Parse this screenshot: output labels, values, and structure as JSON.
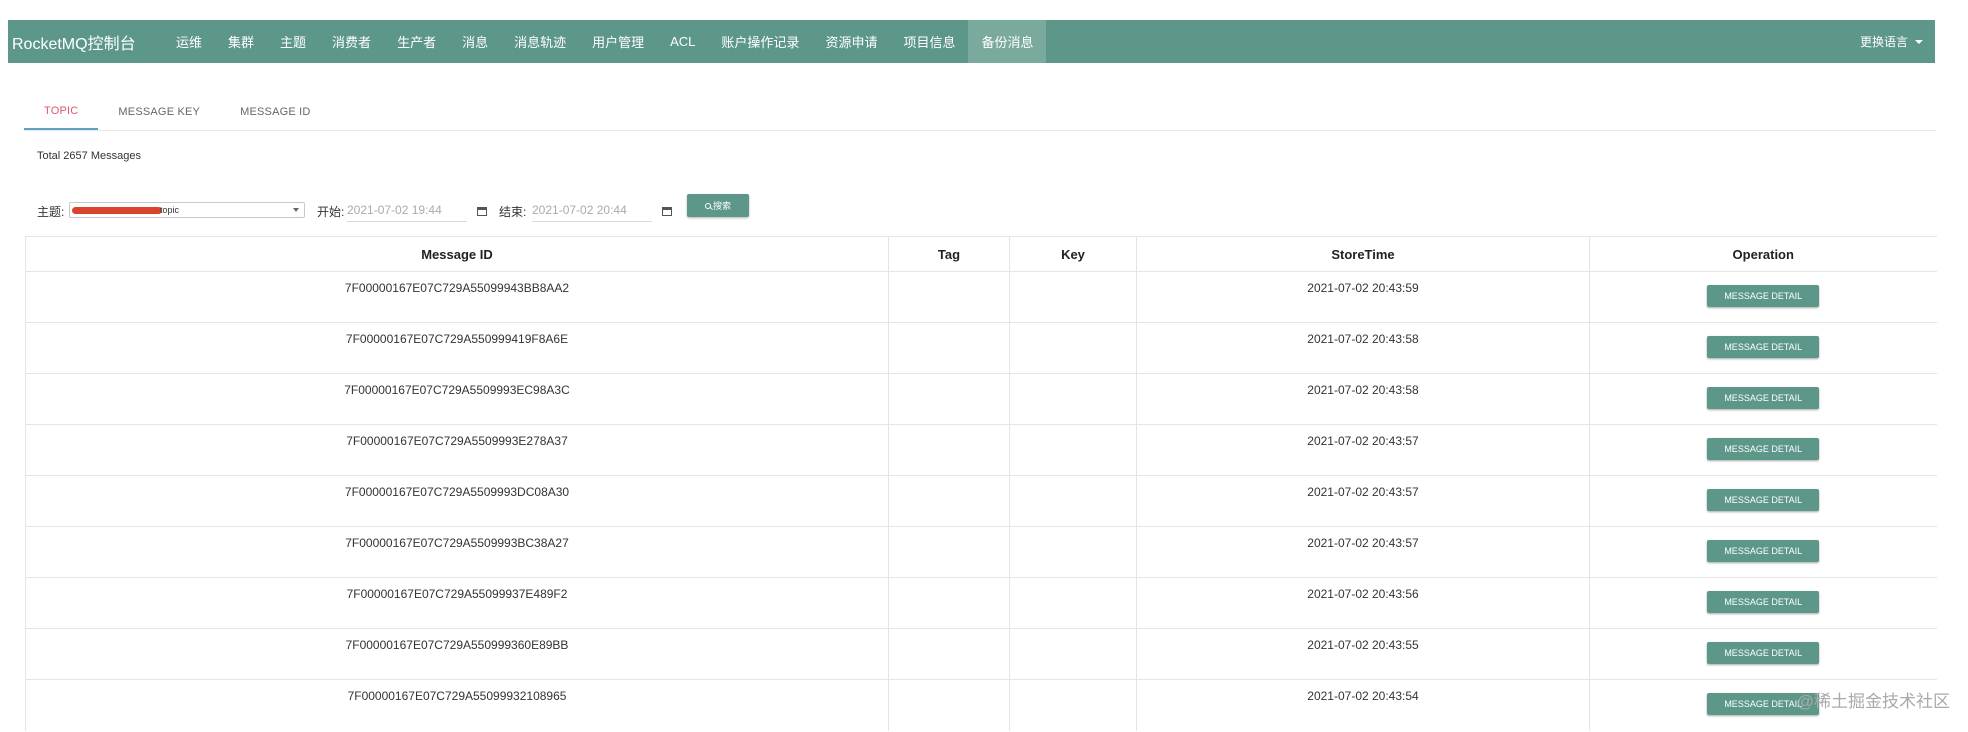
{
  "nav": {
    "brand": "RocketMQ控制台",
    "items": [
      {
        "label": "运维"
      },
      {
        "label": "集群"
      },
      {
        "label": "主题"
      },
      {
        "label": "消费者"
      },
      {
        "label": "生产者"
      },
      {
        "label": "消息"
      },
      {
        "label": "消息轨迹"
      },
      {
        "label": "用户管理"
      },
      {
        "label": "ACL"
      },
      {
        "label": "账户操作记录"
      },
      {
        "label": "资源申请"
      },
      {
        "label": "项目信息"
      },
      {
        "label": "备份消息",
        "active": true
      }
    ],
    "language": "更换语言"
  },
  "tabs": [
    {
      "label": "TOPIC",
      "active": true
    },
    {
      "label": "MESSAGE KEY"
    },
    {
      "label": "MESSAGE ID"
    }
  ],
  "summary": {
    "total_text": "Total 2657 Messages"
  },
  "filter": {
    "topic_label": "主题:",
    "topic_value": "topic",
    "start_label": "开始:",
    "start_value": "2021-07-02 19:44",
    "end_label": "结束:",
    "end_value": "2021-07-02 20:44",
    "search_label": "搜索"
  },
  "table": {
    "headers": [
      "Message ID",
      "Tag",
      "Key",
      "StoreTime",
      "Operation"
    ],
    "button_label": "MESSAGE DETAIL",
    "rows": [
      {
        "id": "7F00000167E07C729A55099943BB8AA2",
        "tag": "",
        "key": "",
        "time": "2021-07-02 20:43:59"
      },
      {
        "id": "7F00000167E07C729A550999419F8A6E",
        "tag": "",
        "key": "",
        "time": "2021-07-02 20:43:58"
      },
      {
        "id": "7F00000167E07C729A5509993EC98A3C",
        "tag": "",
        "key": "",
        "time": "2021-07-02 20:43:58"
      },
      {
        "id": "7F00000167E07C729A5509993E278A37",
        "tag": "",
        "key": "",
        "time": "2021-07-02 20:43:57"
      },
      {
        "id": "7F00000167E07C729A5509993DC08A30",
        "tag": "",
        "key": "",
        "time": "2021-07-02 20:43:57"
      },
      {
        "id": "7F00000167E07C729A5509993BC38A27",
        "tag": "",
        "key": "",
        "time": "2021-07-02 20:43:57"
      },
      {
        "id": "7F00000167E07C729A55099937E489F2",
        "tag": "",
        "key": "",
        "time": "2021-07-02 20:43:56"
      },
      {
        "id": "7F00000167E07C729A550999360E89BB",
        "tag": "",
        "key": "",
        "time": "2021-07-02 20:43:55"
      },
      {
        "id": "7F00000167E07C729A55099932108965",
        "tag": "",
        "key": "",
        "time": "2021-07-02 20:43:54"
      }
    ]
  },
  "watermark": "@稀土掘金技术社区"
}
